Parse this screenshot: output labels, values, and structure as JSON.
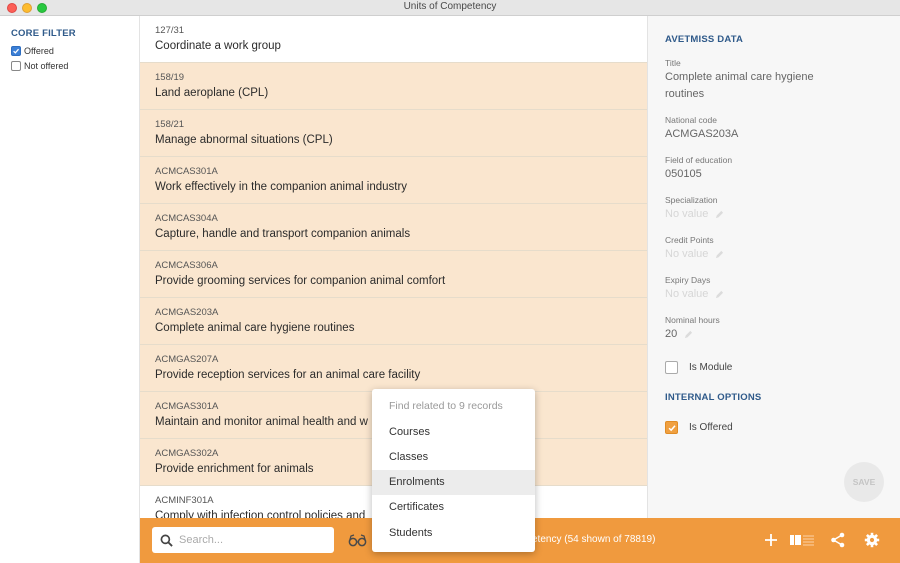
{
  "window": {
    "title": "Units of Competency"
  },
  "sidebar": {
    "title": "CORE FILTER",
    "options": [
      {
        "label": "Offered",
        "checked": true
      },
      {
        "label": "Not offered",
        "checked": false
      }
    ]
  },
  "list": {
    "rows": [
      {
        "code": "127/31",
        "name": "Coordinate a work group",
        "selected": false
      },
      {
        "code": "158/19",
        "name": "Land aeroplane (CPL)",
        "selected": true
      },
      {
        "code": "158/21",
        "name": "Manage abnormal situations (CPL)",
        "selected": true
      },
      {
        "code": "ACMCAS301A",
        "name": "Work effectively in the companion animal industry",
        "selected": true
      },
      {
        "code": "ACMCAS304A",
        "name": "Capture, handle and transport companion animals",
        "selected": true
      },
      {
        "code": "ACMCAS306A",
        "name": "Provide grooming services for companion animal comfort",
        "selected": true
      },
      {
        "code": "ACMGAS203A",
        "name": "Complete animal care hygiene routines",
        "selected": true
      },
      {
        "code": "ACMGAS207A",
        "name": "Provide reception services for an animal care facility",
        "selected": true
      },
      {
        "code": "ACMGAS301A",
        "name": "Maintain and monitor animal health and w",
        "selected": true
      },
      {
        "code": "ACMGAS302A",
        "name": "Provide enrichment for animals",
        "selected": true
      },
      {
        "code": "ACMINF301A",
        "name": "Comply with infection control policies and",
        "selected": false
      }
    ]
  },
  "detail": {
    "avetmiss_title": "AVETMISS DATA",
    "fields": {
      "title": {
        "label": "Title",
        "value": "Complete animal care hygiene routines"
      },
      "national_code": {
        "label": "National code",
        "value": "ACMGAS203A"
      },
      "field_of_education": {
        "label": "Field of education",
        "value": "050105"
      },
      "specialization": {
        "label": "Specialization",
        "value": "No value"
      },
      "credit_points": {
        "label": "Credit Points",
        "value": "No value"
      },
      "expiry_days": {
        "label": "Expiry Days",
        "value": "No value"
      },
      "nominal_hours": {
        "label": "Nominal hours",
        "value": "20"
      }
    },
    "is_module": {
      "label": "Is Module",
      "checked": false
    },
    "internal_title": "INTERNAL OPTIONS",
    "is_offered": {
      "label": "Is Offered",
      "checked": true
    },
    "save_label": "SAVE"
  },
  "bottombar": {
    "search_placeholder": "Search...",
    "status": "etency (54 shown of 78819)"
  },
  "popup": {
    "header": "Find related to 9 records",
    "items": [
      "Courses",
      "Classes",
      "Enrolments",
      "Certificates",
      "Students"
    ],
    "highlighted": "Enrolments"
  },
  "colors": {
    "accent": "#f09a3e",
    "selected_row": "#fae6cf",
    "section_heading": "#2f5a8a"
  },
  "icons": [
    "search-icon",
    "glasses-icon",
    "add-icon",
    "view-toggle-icon",
    "share-icon",
    "settings-icon",
    "pencil-icon",
    "check-icon"
  ]
}
